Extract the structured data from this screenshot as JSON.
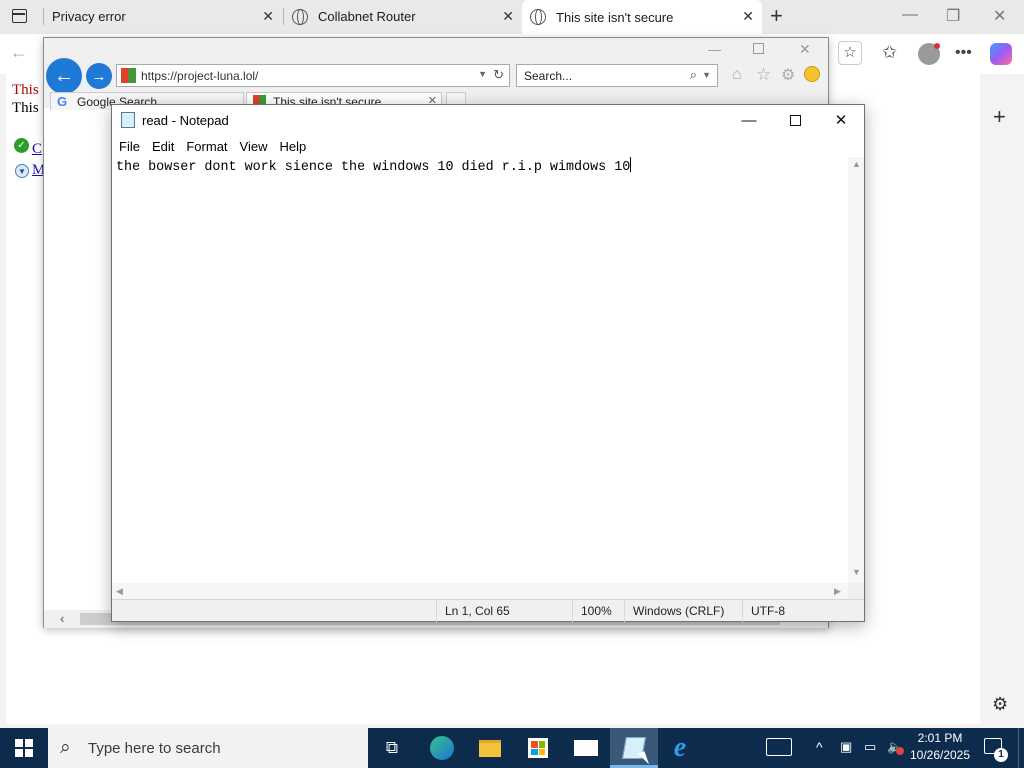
{
  "edge": {
    "tabs": [
      {
        "label": "Privacy error"
      },
      {
        "label": "Collabnet Router"
      },
      {
        "label": "This site isn't secure"
      }
    ],
    "page_lines": [
      "This",
      "This"
    ],
    "page_links": [
      "C",
      "M"
    ]
  },
  "ie": {
    "address": "https://project-luna.lol/",
    "search_placeholder": "Search...",
    "tabs": [
      {
        "label": "Google Search"
      },
      {
        "label": "This site isn't secure"
      }
    ]
  },
  "notepad": {
    "title": "read - Notepad",
    "menu": [
      "File",
      "Edit",
      "Format",
      "View",
      "Help"
    ],
    "content": "the bowser dont work sience the windows 10 died r.i.p wimdows 10",
    "status": {
      "position": "Ln 1, Col 65",
      "zoom": "100%",
      "line_ending": "Windows (CRLF)",
      "encoding": "UTF-8"
    }
  },
  "taskbar": {
    "search_placeholder": "Type here to search",
    "time": "2:01 PM",
    "date": "10/26/2025",
    "notification_count": "1"
  },
  "colors": {
    "taskbar_bg": "#0d2b4c",
    "ie_nav_blue": "#1f7ad6"
  }
}
